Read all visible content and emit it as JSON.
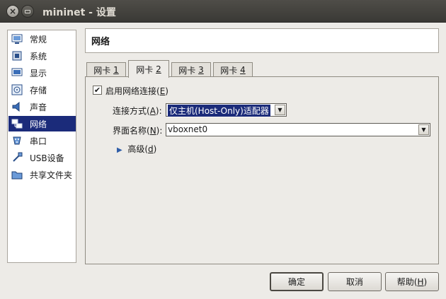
{
  "window": {
    "title": "mininet - 设置"
  },
  "sidebar": {
    "items": [
      {
        "label": "常规",
        "icon": "general-icon"
      },
      {
        "label": "系统",
        "icon": "system-icon"
      },
      {
        "label": "显示",
        "icon": "display-icon"
      },
      {
        "label": "存储",
        "icon": "storage-icon"
      },
      {
        "label": "声音",
        "icon": "audio-icon"
      },
      {
        "label": "网络",
        "icon": "network-icon",
        "selected": true
      },
      {
        "label": "串口",
        "icon": "serial-port-icon"
      },
      {
        "label": "USB设备",
        "icon": "usb-icon"
      },
      {
        "label": "共享文件夹",
        "icon": "shared-folder-icon"
      }
    ]
  },
  "page": {
    "header": "网络"
  },
  "tabs": [
    {
      "label": "网卡",
      "key": "1"
    },
    {
      "label": "网卡",
      "key": "2",
      "active": true
    },
    {
      "label": "网卡",
      "key": "3"
    },
    {
      "label": "网卡",
      "key": "4"
    }
  ],
  "adapter": {
    "enable": {
      "label": "启用网络连接(",
      "key": "E",
      "suffix": ")",
      "checked": true,
      "mark": "✔"
    },
    "attached_to": {
      "label": "连接方式(",
      "key": "A",
      "suffix": "):",
      "value": "仅主机(Host-Only)适配器"
    },
    "name": {
      "label": "界面名称(",
      "key": "N",
      "suffix": "):",
      "value": "vboxnet0"
    },
    "advanced": {
      "label": "高级(",
      "key": "d",
      "suffix": ")"
    }
  },
  "buttons": {
    "ok": "确定",
    "cancel": "取消",
    "help": {
      "label": "帮助(",
      "key": "H",
      "suffix": ")"
    }
  },
  "colors": {
    "selection": "#1b2b7a",
    "titlebar": "#3f3e3a"
  }
}
